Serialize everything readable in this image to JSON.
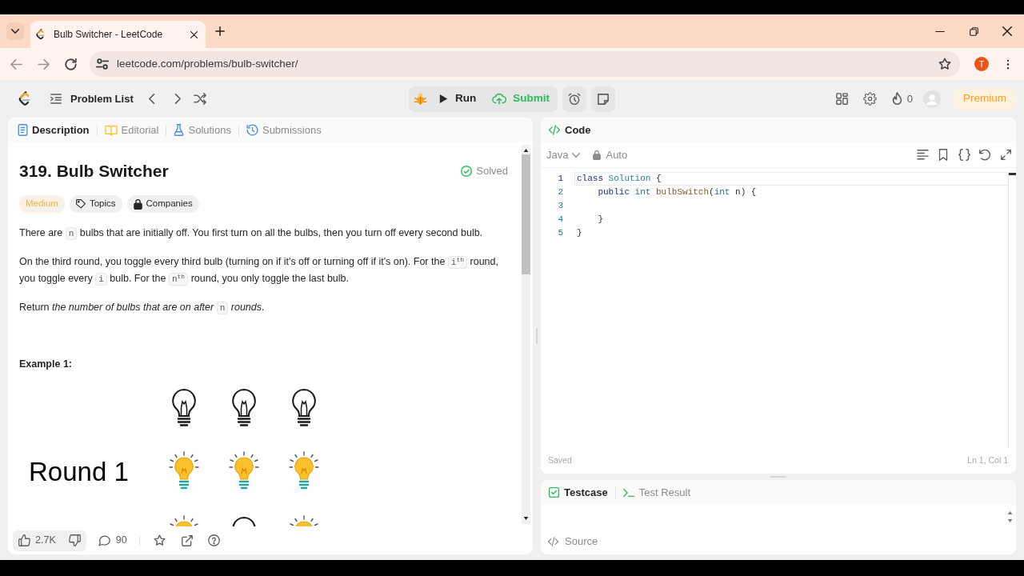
{
  "browser": {
    "tabs": [
      {
        "title": "Bulb Switcher - LeetCode",
        "selected": true
      }
    ],
    "url": "leetcode.com/problems/bulb-switcher/",
    "profile_initial": "T"
  },
  "toolbar": {
    "problem_list": "Problem List",
    "run": "Run",
    "submit": "Submit",
    "streak": "0",
    "premium": "Premium"
  },
  "description_tabs": [
    {
      "label": "Description",
      "kind": "description",
      "selected": true
    },
    {
      "label": "Editorial",
      "kind": "editorial",
      "selected": false
    },
    {
      "label": "Solutions",
      "kind": "solutions",
      "selected": false
    },
    {
      "label": "Submissions",
      "kind": "submissions",
      "selected": false
    }
  ],
  "problem": {
    "title": "319. Bulb Switcher",
    "status": "Solved",
    "difficulty": "Medium",
    "tags": [
      {
        "label": "Topics",
        "kind": "topics"
      },
      {
        "label": "Companies",
        "kind": "companies"
      }
    ],
    "paragraphs": [
      [
        {
          "kind": "text",
          "text": "There are "
        },
        {
          "kind": "code",
          "text": "n"
        },
        {
          "kind": "text",
          "text": " bulbs that are initially off. You first turn on all the bulbs, then you turn off every second bulb."
        }
      ],
      [
        {
          "kind": "text",
          "text": "On the third round, you toggle every third bulb (turning on if it's off or turning off if it's on). For the "
        },
        {
          "kind": "code",
          "text": "i$^{th}$"
        },
        {
          "kind": "text",
          "text": " round, you toggle every "
        },
        {
          "kind": "code",
          "text": "i"
        },
        {
          "kind": "text",
          "text": " bulb. For the "
        },
        {
          "kind": "code",
          "text": "n$^{th}$"
        },
        {
          "kind": "text",
          "text": " round, you only toggle the last bulb."
        }
      ],
      [
        {
          "kind": "text",
          "text": "Return *the number of bulbs that are on after* "
        },
        {
          "kind": "code",
          "text": "n"
        },
        {
          "kind": "text",
          "text": " *rounds*."
        }
      ]
    ]
  },
  "example": {
    "title": "Example 1:",
    "rows": [
      {
        "bulbs": [
          {
            "on": false
          },
          {
            "on": false
          },
          {
            "on": false
          }
        ]
      },
      {
        "label": "Round 1",
        "bulbs": [
          {
            "on": true
          },
          {
            "on": true
          },
          {
            "on": true
          }
        ]
      },
      {
        "bulbs": [
          {
            "on": true
          },
          {
            "on": false
          },
          {
            "on": true
          }
        ]
      }
    ]
  },
  "footer": {
    "likes": "2.7K",
    "comments": "90"
  },
  "code": {
    "title": "Code",
    "language": "Java",
    "mode": "Auto",
    "lines": [
      {
        "number": "1",
        "current": true,
        "tokens": [
          {
            "kind": "keyword",
            "text": "class"
          },
          {
            "kind": "class",
            "text": " Solution"
          },
          {
            "kind": "plain",
            "text": " {"
          }
        ]
      },
      {
        "number": "2",
        "current": false,
        "tokens": [
          {
            "kind": "keyword",
            "text": "    public"
          },
          {
            "kind": "type",
            "text": " int"
          },
          {
            "kind": "function",
            "text": " bulbSwitch"
          },
          {
            "kind": "plain",
            "text": "("
          },
          {
            "kind": "type",
            "text": "int"
          },
          {
            "kind": "plain",
            "text": " n) {"
          }
        ]
      },
      {
        "number": "3",
        "current": false
      },
      {
        "number": "4",
        "current": false,
        "tokens": [
          {
            "kind": "plain",
            "text": "    }"
          }
        ]
      },
      {
        "number": "5",
        "current": false,
        "tokens": [
          {
            "kind": "plain",
            "text": "}"
          }
        ]
      }
    ],
    "status": "Saved",
    "cursor": "Ln 1, Col 1"
  },
  "testcase_tabs": [
    {
      "label": "Testcase",
      "kind": "testcase",
      "selected": true
    },
    {
      "label": "Test Result",
      "kind": "result",
      "selected": false
    }
  ],
  "source": "Source"
}
